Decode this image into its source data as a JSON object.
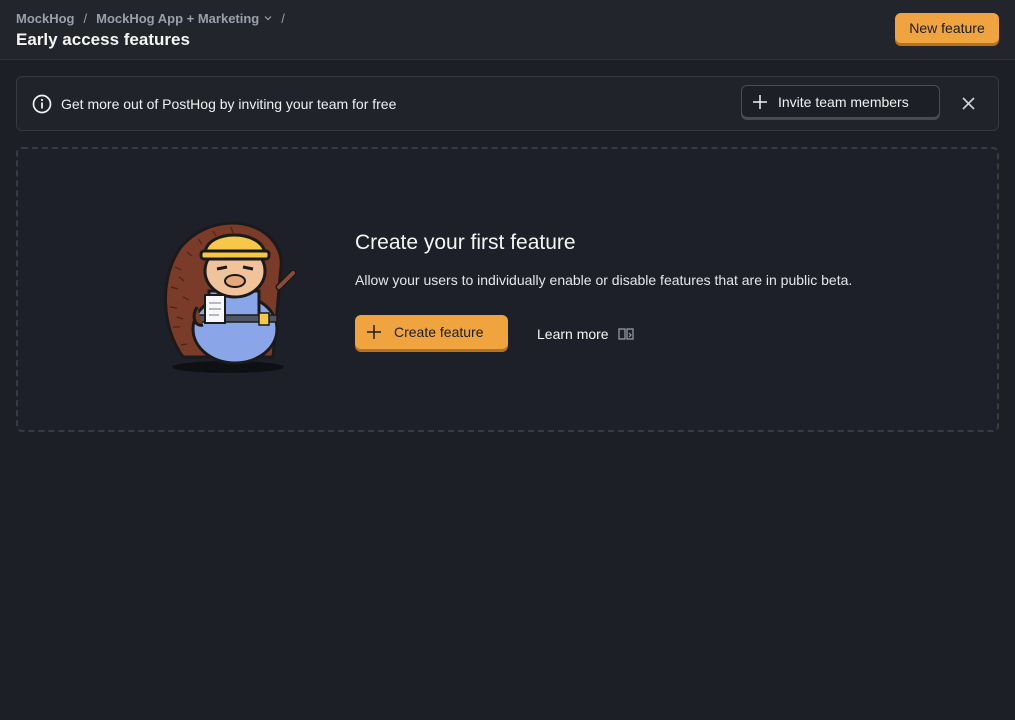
{
  "breadcrumbs": {
    "org": "MockHog",
    "project": "MockHog App + Marketing",
    "separator": "/"
  },
  "header": {
    "title": "Early access features",
    "new_feature_label": "New feature"
  },
  "banner": {
    "text": "Get more out of PostHog by inviting your team for free",
    "invite_label": "Invite team members"
  },
  "empty_state": {
    "title": "Create your first feature",
    "description": "Allow your users to individually enable or disable features that are in public beta.",
    "create_label": "Create feature",
    "learn_more_label": "Learn more"
  },
  "colors": {
    "accent": "#f0a43f",
    "background": "#1d1f27"
  },
  "icons": [
    "info-icon",
    "plus-icon",
    "close-icon",
    "chevron-down-icon",
    "book-icon",
    "hedgehog-illustration"
  ]
}
